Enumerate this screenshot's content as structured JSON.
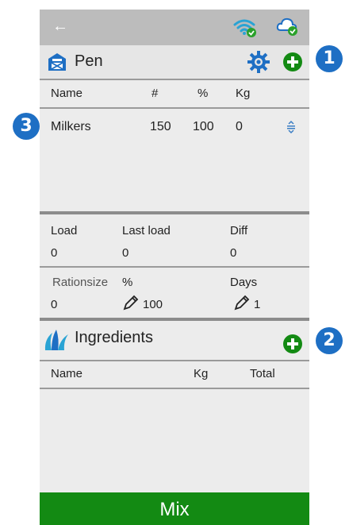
{
  "colors": {
    "accent_blue": "#1e6fc4",
    "add_green": "#138a13",
    "mix_green": "#138a13",
    "status_green": "#2aa12a",
    "header_grey": "#bcbcbc"
  },
  "icons": [
    "back-arrow-icon",
    "wifi-icon",
    "cloud-icon",
    "pen-icon",
    "gear-icon",
    "add-icon",
    "drag-handle-icon",
    "pencil-icon",
    "grass-icon"
  ],
  "topbar": {
    "back_glyph": "←"
  },
  "pen": {
    "title": "Pen",
    "columns": {
      "name": "Name",
      "count": "#",
      "percent": "%",
      "kg": "Kg"
    },
    "rows": [
      {
        "name": "Milkers",
        "count": "150",
        "percent": "100",
        "kg": "0"
      }
    ]
  },
  "load": {
    "load_label": "Load",
    "last_load_label": "Last load",
    "diff_label": "Diff",
    "load_value": "0",
    "last_load_value": "0",
    "diff_value": "0"
  },
  "ration": {
    "rationsize_label": "Rationsize",
    "percent_label": "%",
    "days_label": "Days",
    "rationsize_value": "0",
    "percent_value": "100",
    "days_value": "1"
  },
  "ingredients": {
    "title": "Ingredients",
    "columns": {
      "name": "Name",
      "kg": "Kg",
      "total": "Total"
    }
  },
  "mix_button": "Mix",
  "callouts": {
    "one": "1",
    "two": "2",
    "three": "3"
  }
}
